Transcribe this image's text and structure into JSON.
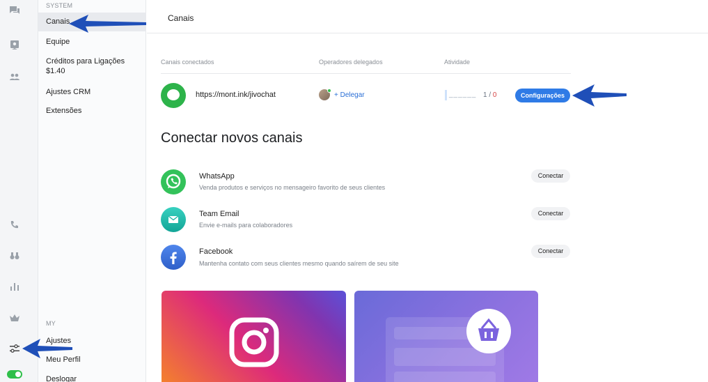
{
  "sidebar": {
    "section_system": "SYSTEM",
    "items_system": [
      {
        "label": "Canais",
        "active": true
      },
      {
        "label": "Equipe"
      },
      {
        "label": "Créditos para Ligações",
        "sub": "$1.40"
      },
      {
        "label": "Ajustes CRM"
      },
      {
        "label": "Extensões"
      }
    ],
    "section_my": "MY",
    "items_my": [
      {
        "label": "Ajustes"
      },
      {
        "label": "Meu Perfil"
      },
      {
        "label": "Deslogar"
      }
    ]
  },
  "rail": {
    "icons": [
      "chat-icon",
      "contacts-icon",
      "team-icon",
      "phone-icon",
      "binoculars-icon",
      "stats-icon",
      "crown-icon",
      "settings-sliders-icon"
    ],
    "status_toggle_on": true
  },
  "header": {
    "title": "Canais"
  },
  "connected": {
    "columns": [
      "Canais conectados",
      "Operadores delegados",
      "Atividade"
    ],
    "row": {
      "url": "https://mont.ink/jivochat",
      "delegate_label": "+ Delegar",
      "activity_placeholder": "______",
      "activity_count": "1",
      "activity_sep": " / ",
      "activity_zero": "0",
      "config_button": "Configurações"
    }
  },
  "new_channels": {
    "title": "Conectar novos canais",
    "items": [
      {
        "name": "WhatsApp",
        "desc": "Venda produtos e serviços no mensageiro favorito de seus clientes",
        "button": "Conectar",
        "color": "#33c25a"
      },
      {
        "name": "Team Email",
        "desc": "Envie e-mails para colaboradores",
        "button": "Conectar",
        "color": "#1fb7a8"
      },
      {
        "name": "Facebook",
        "desc": "Mantenha contato com seus clientes mesmo quando saírem de seu site",
        "button": "Conectar",
        "color": "#3b6fd8"
      }
    ]
  },
  "colors": {
    "accent": "#2f7be6",
    "annotation_arrow": "#1f4fb8"
  }
}
